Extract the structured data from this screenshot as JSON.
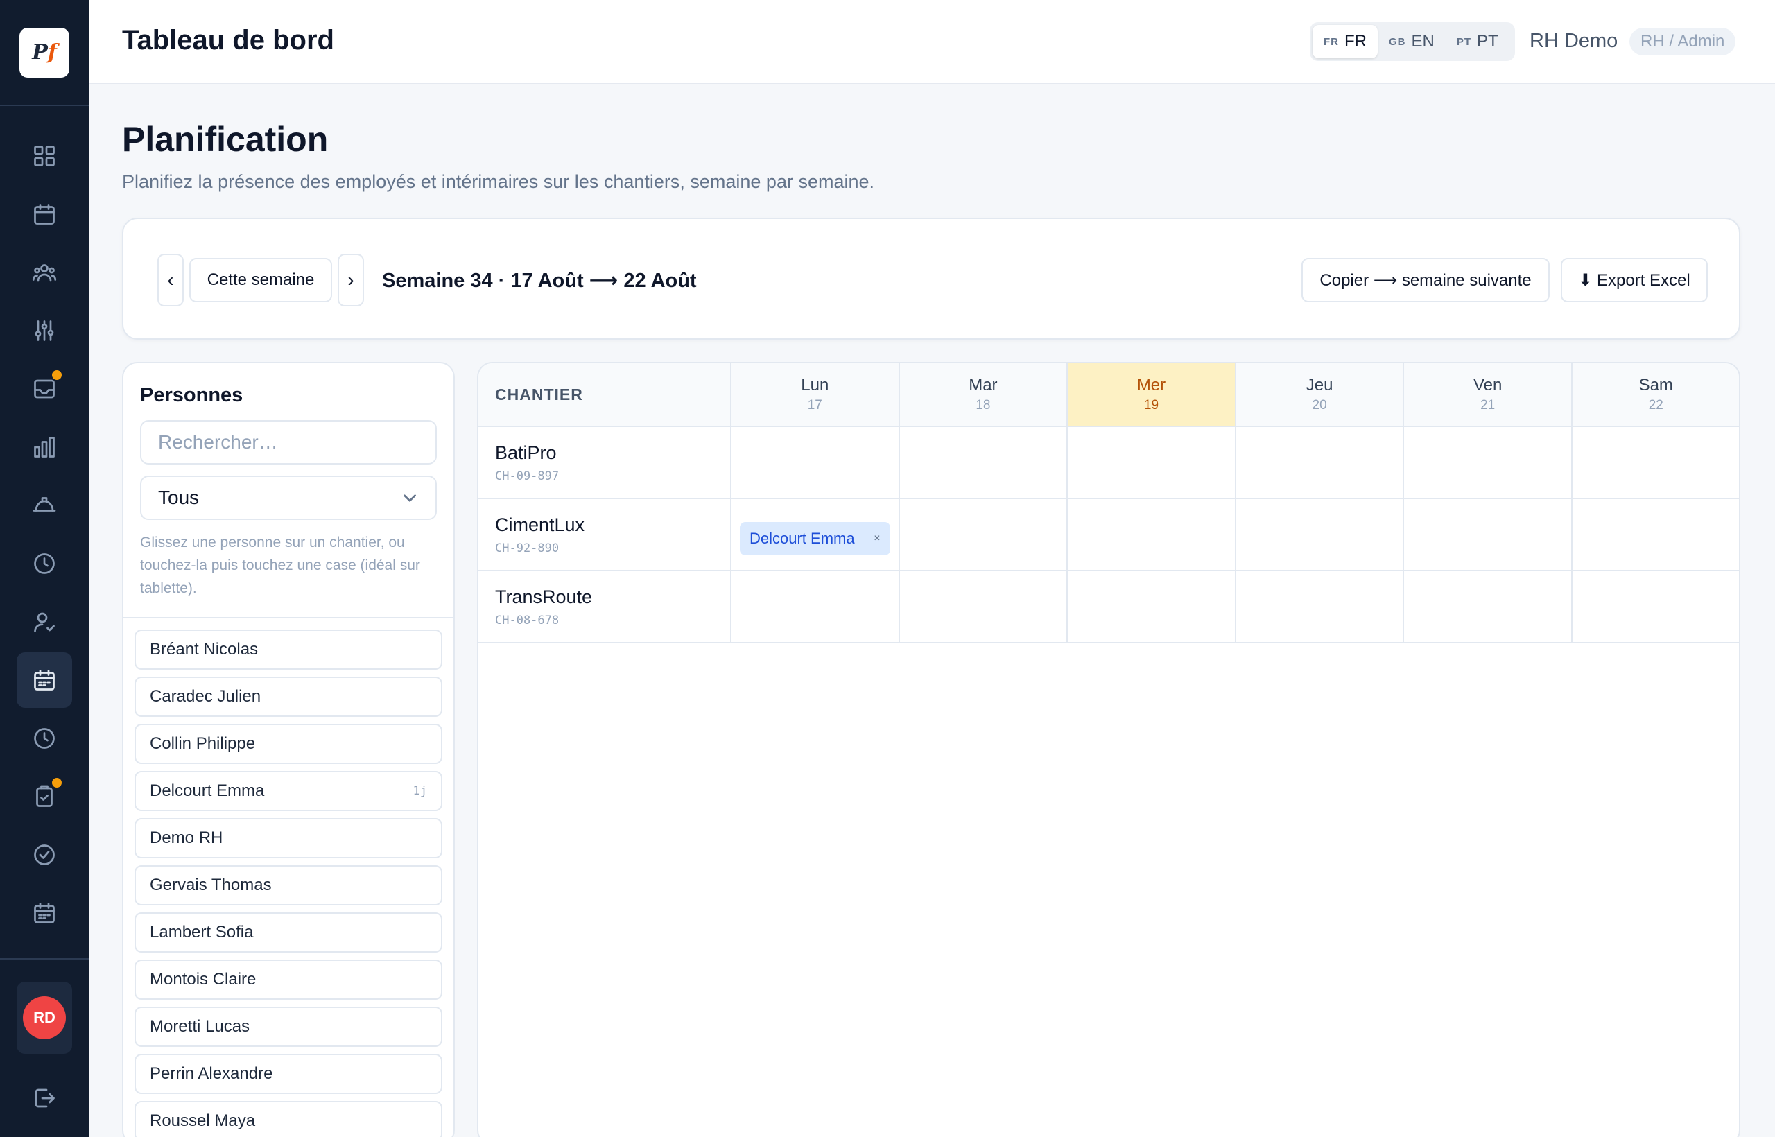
{
  "app": {
    "logo_text": "Pf",
    "top_title": "Tableau de bord",
    "languages": [
      {
        "code": "FR",
        "label": "FR",
        "active": true
      },
      {
        "code": "GB",
        "label": "EN",
        "active": false
      },
      {
        "code": "PT",
        "label": "PT",
        "active": false
      }
    ],
    "user_name": "RH Demo",
    "role": "RH / Admin",
    "avatar_initials": "RD",
    "colors": {
      "accent": "#f59e0b",
      "sidebar": "#111c2e",
      "today": "#fdf1c4",
      "chip": "#dbeafe",
      "avatar": "#ef4444"
    }
  },
  "sidebar": {
    "items": [
      {
        "icon": "grid-icon",
        "active": false,
        "badge": false
      },
      {
        "icon": "calendar-icon",
        "active": false,
        "badge": false
      },
      {
        "icon": "users-icon",
        "active": false,
        "badge": false
      },
      {
        "icon": "sliders-icon",
        "active": false,
        "badge": false
      },
      {
        "icon": "inbox-icon",
        "active": false,
        "badge": true
      },
      {
        "icon": "bar-chart-icon",
        "active": false,
        "badge": false
      },
      {
        "icon": "helmet-icon",
        "active": false,
        "badge": false
      },
      {
        "icon": "clock-icon",
        "active": false,
        "badge": false
      },
      {
        "icon": "user-check-icon",
        "active": false,
        "badge": false
      },
      {
        "icon": "calendar-grid-icon",
        "active": true,
        "badge": false
      },
      {
        "icon": "clock-icon",
        "active": false,
        "badge": false
      },
      {
        "icon": "clipboard-check-icon",
        "active": false,
        "badge": true
      },
      {
        "icon": "check-circle-icon",
        "active": false,
        "badge": false
      },
      {
        "icon": "calendar-grid-icon",
        "active": false,
        "badge": false
      }
    ],
    "logout_icon": "logout-icon"
  },
  "page": {
    "title": "Planification",
    "subtitle": "Planifiez la présence des employés et intérimaires sur les chantiers, semaine par semaine."
  },
  "toolbar": {
    "prev_label": "‹",
    "today_label": "Cette semaine",
    "next_label": "›",
    "week_label": "Semaine 34 · 17 Août ⟶ 22 Août",
    "copy_label": "Copier ⟶ semaine suivante",
    "export_label": "⬇ Export Excel"
  },
  "people": {
    "title": "Personnes",
    "search_placeholder": "Rechercher…",
    "filter_value": "Tous",
    "hint": "Glissez une personne sur un chantier, ou touchez-la puis touchez une case (idéal sur tablette).",
    "list": [
      {
        "name": "Bréant Nicolas",
        "count": ""
      },
      {
        "name": "Caradec Julien",
        "count": ""
      },
      {
        "name": "Collin Philippe",
        "count": ""
      },
      {
        "name": "Delcourt Emma",
        "count": "1j"
      },
      {
        "name": "Demo RH",
        "count": ""
      },
      {
        "name": "Gervais Thomas",
        "count": ""
      },
      {
        "name": "Lambert Sofia",
        "count": ""
      },
      {
        "name": "Montois Claire",
        "count": ""
      },
      {
        "name": "Moretti Lucas",
        "count": ""
      },
      {
        "name": "Perrin Alexandre",
        "count": ""
      },
      {
        "name": "Roussel Maya",
        "count": ""
      }
    ]
  },
  "grid": {
    "site_header": "CHANTIER",
    "days": [
      {
        "name": "Lun",
        "num": "17",
        "today": false
      },
      {
        "name": "Mar",
        "num": "18",
        "today": false
      },
      {
        "name": "Mer",
        "num": "19",
        "today": true
      },
      {
        "name": "Jeu",
        "num": "20",
        "today": false
      },
      {
        "name": "Ven",
        "num": "21",
        "today": false
      },
      {
        "name": "Sam",
        "num": "22",
        "today": false
      }
    ],
    "sites": [
      {
        "name": "BatiPro",
        "code": "CH-09-897",
        "assignments": [
          [],
          [],
          [],
          [],
          [],
          []
        ]
      },
      {
        "name": "CimentLux",
        "code": "CH-92-890",
        "assignments": [
          [
            "Delcourt Emma"
          ],
          [],
          [],
          [],
          [],
          []
        ]
      },
      {
        "name": "TransRoute",
        "code": "CH-08-678",
        "assignments": [
          [],
          [],
          [],
          [],
          [],
          []
        ]
      }
    ],
    "remove_label": "×"
  }
}
